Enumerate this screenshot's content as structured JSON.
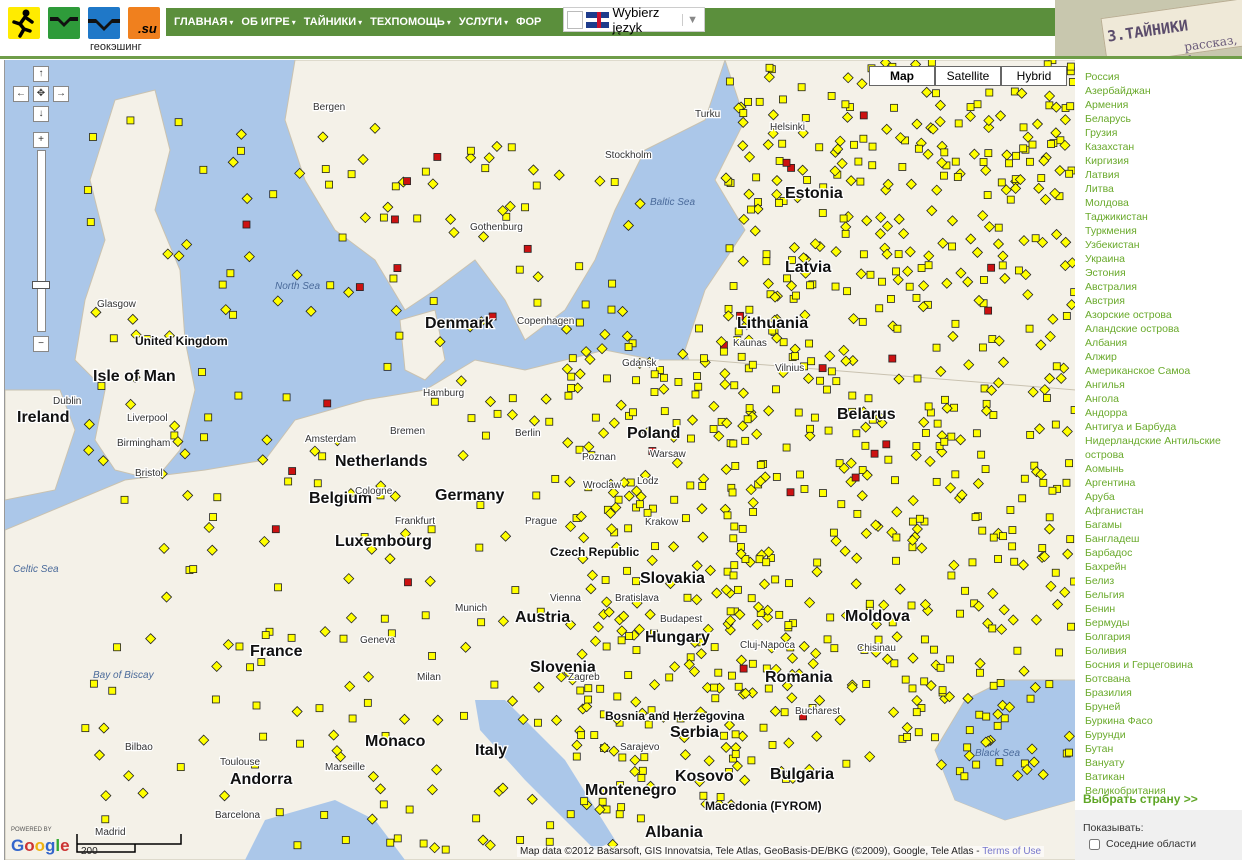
{
  "header": {
    "site_name": "геокэшинг",
    "logo_su": ".su",
    "nav": [
      "ГЛАВНАЯ",
      "ОБ ИГРЕ",
      "ТАЙНИКИ",
      "ТЕХПОМОЩЬ",
      "УСЛУГИ",
      "ФОР"
    ],
    "language_select": "Wybierz język",
    "corner_badge_title": "3.ТАЙНИКИ",
    "corner_badge_sub": "рассказ, ф"
  },
  "map": {
    "types": [
      "Map",
      "Satellite",
      "Hybrid"
    ],
    "selected_type": "Map",
    "zoom_level_fraction": 0.5,
    "labels": [
      {
        "text": "United Kingdom",
        "kind": "country"
      },
      {
        "text": "Germany",
        "kind": "country"
      },
      {
        "text": "Poland",
        "kind": "country"
      },
      {
        "text": "France",
        "kind": "country"
      },
      {
        "text": "Romania",
        "kind": "country"
      },
      {
        "text": "Latvia",
        "kind": "country"
      },
      {
        "text": "Lithuania",
        "kind": "country"
      },
      {
        "text": "Denmark",
        "kind": "country"
      },
      {
        "text": "Netherlands",
        "kind": "country"
      },
      {
        "text": "Hungary",
        "kind": "country"
      },
      {
        "text": "Serbia",
        "kind": "country"
      },
      {
        "text": "Italy",
        "kind": "country"
      },
      {
        "text": "Bulgaria",
        "kind": "country"
      },
      {
        "text": "Bosnia and Herzegovina",
        "kind": "country"
      },
      {
        "text": "Macedonia (FYROM)",
        "kind": "country"
      },
      {
        "text": "Albania",
        "kind": "country"
      },
      {
        "text": "Estonia",
        "kind": "country"
      },
      {
        "text": "Luxembourg",
        "kind": "country"
      },
      {
        "text": "Czech Republic",
        "kind": "country"
      },
      {
        "text": "Slovakia",
        "kind": "country"
      },
      {
        "text": "Austria",
        "kind": "country"
      },
      {
        "text": "Slovenia",
        "kind": "country"
      },
      {
        "text": "Moldova",
        "kind": "country"
      },
      {
        "text": "Montenegro",
        "kind": "country"
      },
      {
        "text": "Kosovo",
        "kind": "country"
      },
      {
        "text": "Belarus",
        "kind": "country"
      },
      {
        "text": "Belgium",
        "kind": "country"
      },
      {
        "text": "Ireland",
        "kind": "country"
      },
      {
        "text": "Isle of Man",
        "kind": "country"
      },
      {
        "text": "Andorra",
        "kind": "country"
      },
      {
        "text": "Monaco",
        "kind": "country"
      },
      {
        "text": "North Sea",
        "kind": "sea"
      },
      {
        "text": "Baltic Sea",
        "kind": "sea"
      },
      {
        "text": "Black Sea",
        "kind": "sea"
      },
      {
        "text": "Bay of Biscay",
        "kind": "sea"
      },
      {
        "text": "Celtic Sea",
        "kind": "sea"
      },
      {
        "text": "Glasgow",
        "kind": "city"
      },
      {
        "text": "Dublin",
        "kind": "city"
      },
      {
        "text": "Liverpool",
        "kind": "city"
      },
      {
        "text": "Birmingham",
        "kind": "city"
      },
      {
        "text": "Bristol",
        "kind": "city"
      },
      {
        "text": "Bergen",
        "kind": "city"
      },
      {
        "text": "Stockholm",
        "kind": "city"
      },
      {
        "text": "Gothenburg",
        "kind": "city"
      },
      {
        "text": "Turku",
        "kind": "city"
      },
      {
        "text": "Helsinki",
        "kind": "city"
      },
      {
        "text": "Copenhagen",
        "kind": "city"
      },
      {
        "text": "Hamburg",
        "kind": "city"
      },
      {
        "text": "Bremen",
        "kind": "city"
      },
      {
        "text": "Berlin",
        "kind": "city"
      },
      {
        "text": "Amsterdam",
        "kind": "city"
      },
      {
        "text": "Cologne",
        "kind": "city"
      },
      {
        "text": "Frankfurt",
        "kind": "city"
      },
      {
        "text": "Gdansk",
        "kind": "city"
      },
      {
        "text": "Kaunas",
        "kind": "city"
      },
      {
        "text": "Vilnius",
        "kind": "city"
      },
      {
        "text": "Poznan",
        "kind": "city"
      },
      {
        "text": "Warsaw",
        "kind": "city"
      },
      {
        "text": "Lodz",
        "kind": "city"
      },
      {
        "text": "Wroclaw",
        "kind": "city"
      },
      {
        "text": "Krakow",
        "kind": "city"
      },
      {
        "text": "Prague",
        "kind": "city"
      },
      {
        "text": "Vienna",
        "kind": "city"
      },
      {
        "text": "Bratislava",
        "kind": "city"
      },
      {
        "text": "Budapest",
        "kind": "city"
      },
      {
        "text": "Munich",
        "kind": "city"
      },
      {
        "text": "Zagreb",
        "kind": "city"
      },
      {
        "text": "Cluj-Napoca",
        "kind": "city"
      },
      {
        "text": "Bucharest",
        "kind": "city"
      },
      {
        "text": "Chisinau",
        "kind": "city"
      },
      {
        "text": "Sarajevo",
        "kind": "city"
      },
      {
        "text": "Marseille",
        "kind": "city"
      },
      {
        "text": "Bilbao",
        "kind": "city"
      },
      {
        "text": "Toulouse",
        "kind": "city"
      },
      {
        "text": "Barcelona",
        "kind": "city"
      },
      {
        "text": "Madrid",
        "kind": "city"
      },
      {
        "text": "Milan",
        "kind": "city"
      },
      {
        "text": "Geneva",
        "kind": "city"
      }
    ],
    "attribution": "Map data ©2012 Basarsoft, GIS Innovatsia, Tele Atlas, GeoBasis-DE/BKG (©2009), Google, Tele Atlas -",
    "terms_of_use": "Terms of Use",
    "scale_label": "200",
    "powered_by": "POWERED BY",
    "google": "Google"
  },
  "sidebar": {
    "countries": [
      "Россия",
      "Азербайджан",
      "Армения",
      "Беларусь",
      "Грузия",
      "Казахстан",
      "Киргизия",
      "Латвия",
      "Литва",
      "Молдова",
      "Таджикистан",
      "Туркмения",
      "Узбекистан",
      "Украина",
      "Эстония",
      "Австралия",
      "Австрия",
      "Азорские острова",
      "Аландские острова",
      "Албания",
      "Алжир",
      "Американское Самоа",
      "Ангилья",
      "Ангола",
      "Андорра",
      "Антигуа и Барбуда",
      "Нидерландские Антильские острова",
      "Аомынь",
      "Аргентина",
      "Аруба",
      "Афганистан",
      "Багамы",
      "Бангладеш",
      "Барбадос",
      "Бахрейн",
      "Белиз",
      "Бельгия",
      "Бенин",
      "Бермуды",
      "Болгария",
      "Боливия",
      "Босния и Герцеговина",
      "Ботсвана",
      "Бразилия",
      "Бруней",
      "Буркина Фасо",
      "Бурунди",
      "Бутан",
      "Вануату",
      "Ватикан",
      "Великобритания"
    ],
    "choose_country": "Выбрать страну >>",
    "show_label": "Показывать:",
    "neighbors_label": "Соседние области",
    "neighbors_checked": false
  },
  "colors": {
    "nav_green": "#5b8f3c",
    "sidebar_link": "#6aaa2c",
    "cache_marker": "#ffff00",
    "cache_marker_special": "#cc1111",
    "sea": "#abc7e9",
    "land": "#f4f1e8"
  }
}
